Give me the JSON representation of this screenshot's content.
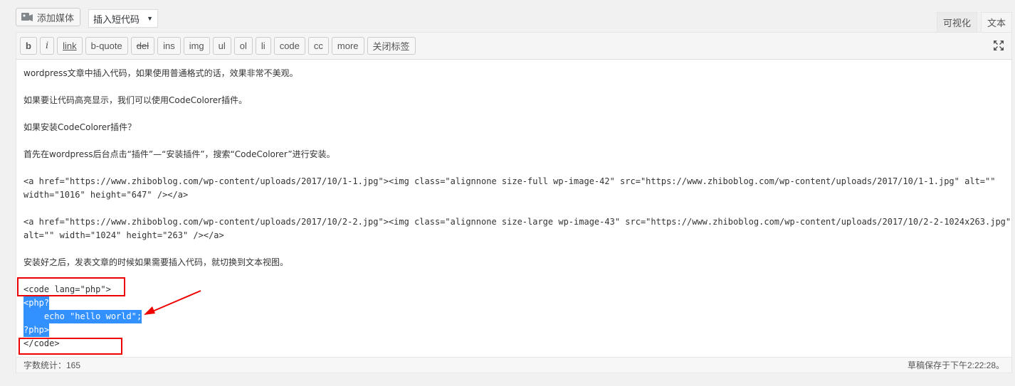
{
  "topbar": {
    "add_media_label": "添加媒体",
    "shortcode_label": "插入短代码",
    "shortcode_caret": "▼"
  },
  "tabs": [
    {
      "label": "可视化",
      "active": false
    },
    {
      "label": "文本",
      "active": true
    }
  ],
  "toolbar": {
    "buttons": [
      "b",
      "i",
      "link",
      "b-quote",
      "del",
      "ins",
      "img",
      "ul",
      "ol",
      "li",
      "code",
      "cc",
      "more",
      "关闭标签"
    ]
  },
  "content": {
    "lines": [
      "wordpress文章中插入代码，如果使用普通格式的话，效果非常不美观。",
      "如果要让代码高亮显示，我们可以使用CodeColorer插件。",
      "如果安装CodeColorer插件？",
      "首先在wordpress后台点击“插件”—“安装插件”，搜索“CodeColorer”进行安装。",
      "<a href=\"https://www.zhiboblog.com/wp-content/uploads/2017/10/1-1.jpg\"><img class=\"alignnone size-full wp-image-42\" src=\"https://www.zhiboblog.com/wp-content/uploads/2017/10/1-1.jpg\" alt=\"\"",
      "width=\"1016\" height=\"647\" /></a>",
      "<a href=\"https://www.zhiboblog.com/wp-content/uploads/2017/10/2-2.jpg\"><img class=\"alignnone size-large wp-image-43\" src=\"https://www.zhiboblog.com/wp-content/uploads/2017/10/2-2-1024x263.jpg\"",
      "alt=\"\" width=\"1024\" height=\"263\" /></a>",
      "安装好之后，发表文章的时候如果需要插入代码，就切换到文本视图。",
      "<code lang=\"php\">",
      "<php?",
      "    echo \"hello world\";",
      "?php>",
      "</code>"
    ]
  },
  "status": {
    "word_count": "字数统计：165",
    "draft_saved": "草稿保存于下午2:22:28。"
  },
  "colors": {
    "annotation": "#e00000",
    "selection": "#3390ff"
  }
}
